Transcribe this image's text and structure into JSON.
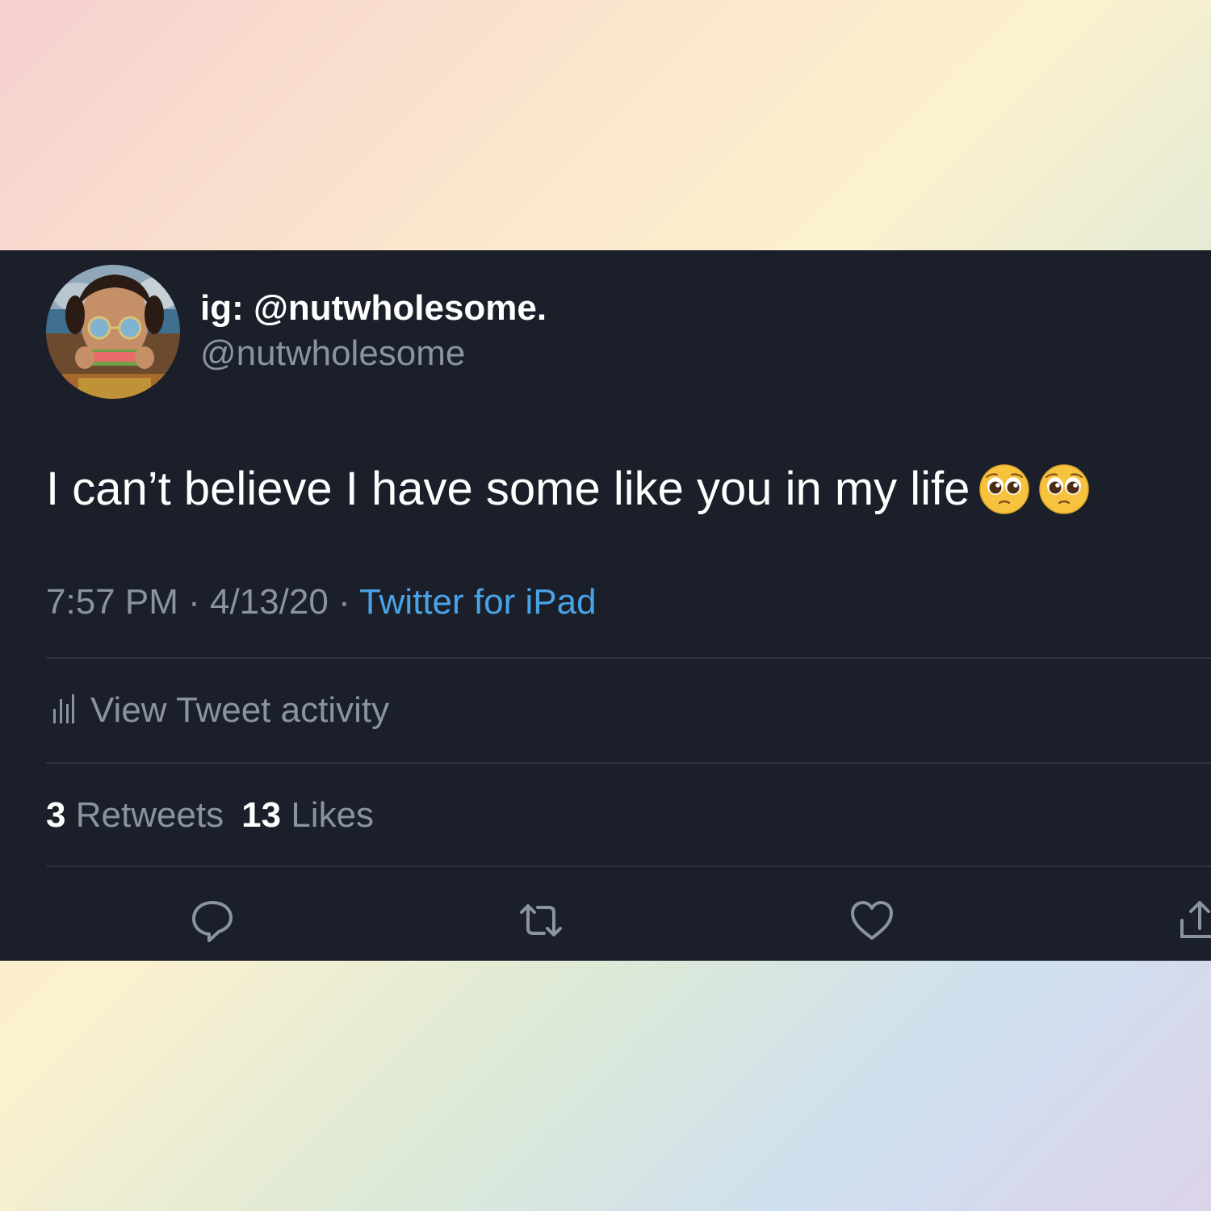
{
  "tweet": {
    "display_name": "ig: @nutwholesome.",
    "handle": "@nutwholesome",
    "text": "I can’t believe I have some like you in my life",
    "emojis": [
      "pleading-face-emoji",
      "pleading-face-emoji"
    ],
    "time": "7:57 PM",
    "date": "4/13/20",
    "separator": " · ",
    "source": "Twitter for iPad"
  },
  "activity": {
    "label": "View Tweet activity",
    "icon": "bar-chart-icon"
  },
  "stats": {
    "retweets_count": "3",
    "retweets_label": "Retweets",
    "likes_count": "13",
    "likes_label": "Likes"
  },
  "actions": [
    {
      "name": "reply",
      "icon": "comment-icon"
    },
    {
      "name": "retweet",
      "icon": "retweet-icon"
    },
    {
      "name": "like",
      "icon": "heart-icon"
    },
    {
      "name": "share",
      "icon": "share-icon"
    }
  ],
  "colors": {
    "card_background": "#1a1f29",
    "primary_text": "#ffffff",
    "secondary_text": "#8a949e",
    "link": "#4aa3e6",
    "divider": "#2c333d"
  }
}
